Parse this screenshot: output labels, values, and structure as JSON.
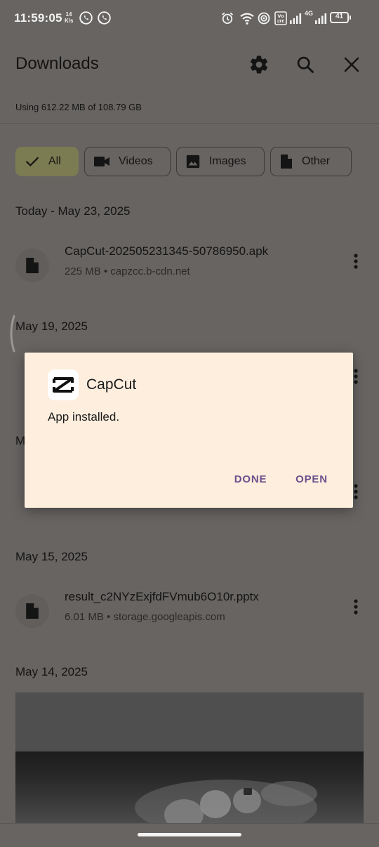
{
  "status_bar": {
    "time": "11:59:05",
    "net_speed_value": "14",
    "net_speed_unit": "K/s",
    "network_type": "4G",
    "volte_label": "Vo LTE",
    "battery": "41"
  },
  "header": {
    "title": "Downloads",
    "storage": "Using 612.22 MB of 108.79 GB"
  },
  "filters": [
    {
      "label": "All",
      "icon": "check-icon",
      "selected": true
    },
    {
      "label": "Videos",
      "icon": "video-camera-icon",
      "selected": false
    },
    {
      "label": "Images",
      "icon": "image-icon",
      "selected": false
    },
    {
      "label": "Other",
      "icon": "document-icon",
      "selected": false
    }
  ],
  "sections": {
    "today": {
      "date": "Today - May 23, 2025",
      "file": {
        "name": "CapCut-202505231345-50786950.apk",
        "meta": "225 MB • capzcc.b-cdn.net"
      }
    },
    "may19": {
      "date": "May 19, 2025"
    },
    "hidden_header_initial": "M",
    "may15": {
      "date": "May 15, 2025",
      "file": {
        "name": "result_c2NYzExjfdFVmub6O10r.pptx",
        "meta": "6.01 MB • storage.googleapis.com"
      }
    },
    "may14": {
      "date": "May 14, 2025"
    }
  },
  "dialog": {
    "app_name": "CapCut",
    "message": "App installed.",
    "done_label": "DONE",
    "open_label": "OPEN"
  },
  "colors": {
    "scrim_background": "#676462",
    "dialog_background": "#fdeede",
    "dialog_button": "#6a4e8c",
    "selected_chip": "#7c7c52"
  }
}
